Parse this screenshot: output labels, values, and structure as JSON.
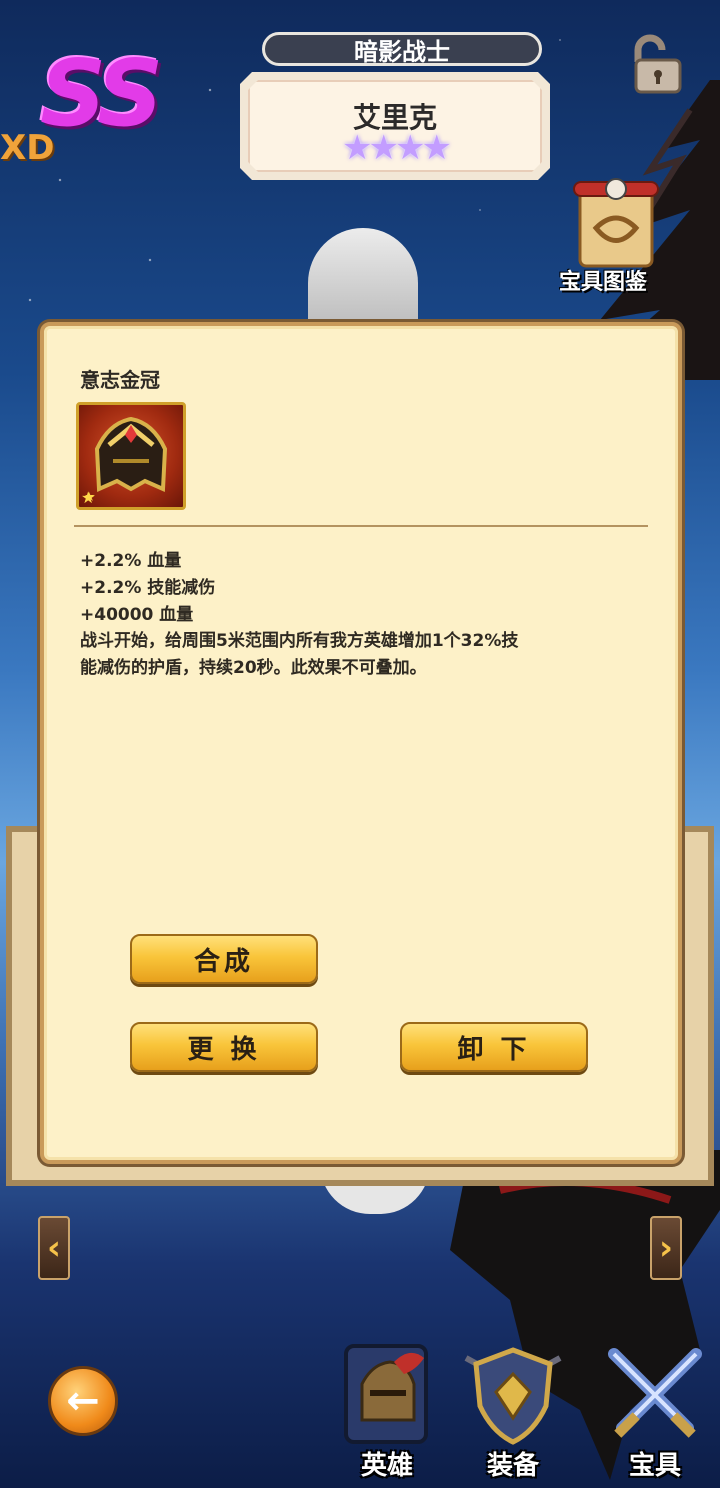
{
  "header": {
    "grade": "SS",
    "partial_text": "XD",
    "hero_class": "暗影战士",
    "hero_name": "艾里克",
    "stars": "★★★★",
    "treasure_guide_label": "宝具图鉴"
  },
  "item": {
    "name": "意志金冠",
    "stars": "★",
    "stats": [
      "+2.2% 血量",
      "+2.2% 技能减伤",
      "+40000 血量"
    ],
    "description": "战斗开始，给周围5米范围内所有我方英雄增加1个32%技能减伤的护盾，持续20秒。此效果不可叠加。"
  },
  "buttons": {
    "synthesize": "合成",
    "replace": "更 换",
    "unequip": "卸 下"
  },
  "arrows": {
    "prev": "‹",
    "next": "›"
  },
  "back": "←",
  "nav": [
    {
      "label": "英雄"
    },
    {
      "label": "装备"
    },
    {
      "label": "宝具"
    }
  ]
}
